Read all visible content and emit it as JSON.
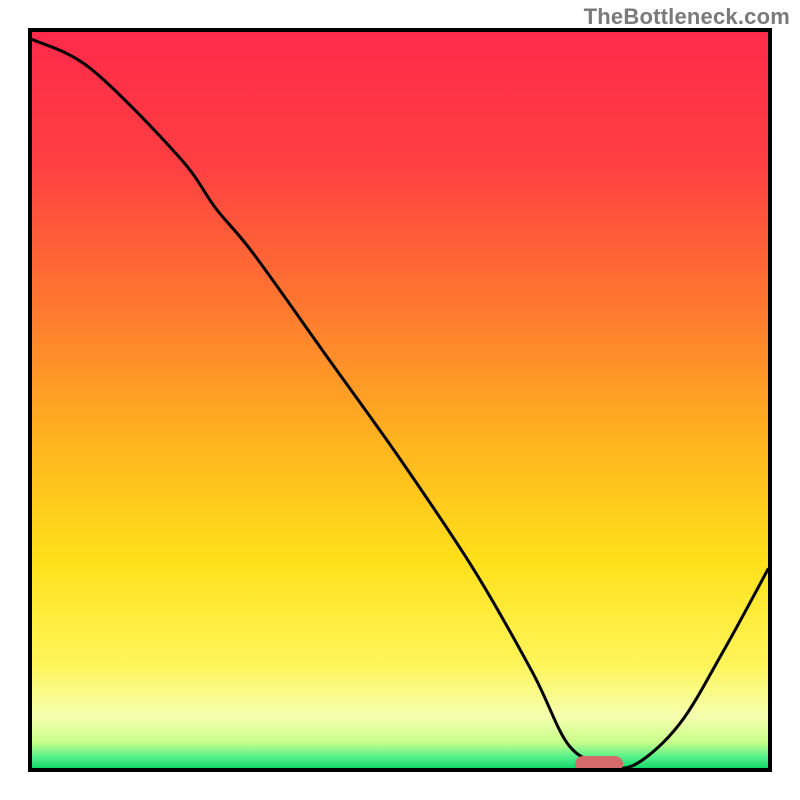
{
  "watermark": "TheBottleneck.com",
  "colors": {
    "border": "#000000",
    "curve": "#000000",
    "marker": "#d46a6a",
    "gradient_stops": [
      {
        "offset": 0.0,
        "color": "#ff2a4a"
      },
      {
        "offset": 0.18,
        "color": "#ff3f42"
      },
      {
        "offset": 0.38,
        "color": "#ff7a2f"
      },
      {
        "offset": 0.55,
        "color": "#ffb21f"
      },
      {
        "offset": 0.72,
        "color": "#ffe11a"
      },
      {
        "offset": 0.86,
        "color": "#fff55a"
      },
      {
        "offset": 0.93,
        "color": "#f6ffb0"
      },
      {
        "offset": 0.965,
        "color": "#c8ff8a"
      },
      {
        "offset": 0.985,
        "color": "#54f08a"
      },
      {
        "offset": 1.0,
        "color": "#14d86a"
      }
    ]
  },
  "chart_data": {
    "type": "line",
    "title": "",
    "xlabel": "",
    "ylabel": "",
    "xlim": [
      0,
      100
    ],
    "ylim": [
      0,
      100
    ],
    "grid": false,
    "legend": false,
    "marker": {
      "x": 77,
      "y": 0.5
    },
    "series": [
      {
        "name": "bottleneck-curve",
        "x": [
          0,
          8,
          20,
          25,
          30,
          40,
          50,
          60,
          68,
          73,
          78,
          82,
          88,
          94,
          100
        ],
        "values": [
          99,
          95,
          83,
          76,
          70,
          56,
          42,
          27,
          13,
          3,
          0.5,
          0.5,
          6,
          16,
          27
        ]
      }
    ],
    "annotations": []
  }
}
